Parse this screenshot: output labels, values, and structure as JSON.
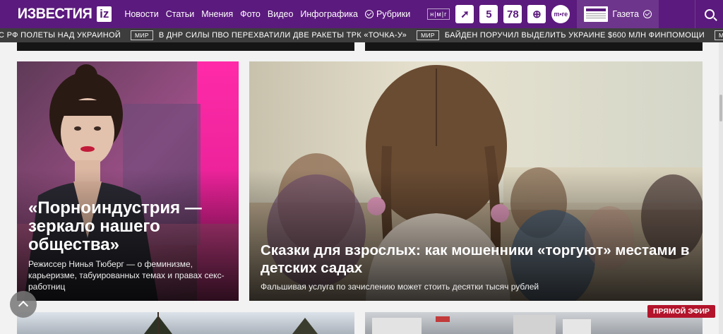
{
  "header": {
    "logo_text": "ИЗВЕСТИЯ",
    "logo_badge": "iz",
    "nav": [
      "Новости",
      "Статьи",
      "Мнения",
      "Фото",
      "Видео",
      "Инфографика"
    ],
    "rubriki_label": "Рубрики",
    "partners": {
      "nmg": "н|м|г",
      "p1": "➚",
      "p2": "5",
      "p3": "78",
      "p4": "⊕",
      "p5": "m•re"
    },
    "gazeta_label": "Газета"
  },
  "ticker": [
    {
      "tag": "",
      "text": "С РФ ПОЛЕТЫ НАД УКРАИНОЙ"
    },
    {
      "tag": "МИР",
      "text": "В ДНР СИЛЫ ПВО ПЕРЕХВАТИЛИ ДВЕ РАКЕТЫ ТРК «ТОЧКА-У»"
    },
    {
      "tag": "МИР",
      "text": "БАЙДЕН ПОРУЧИЛ ВЫДЕЛИТЬ УКРАИНЕ $600 МЛН ФИНПОМОЩИ"
    },
    {
      "tag": "МИР",
      "text": ""
    }
  ],
  "cards": {
    "left": {
      "title": "«Порноиндустрия — зеркало нашего общества»",
      "subtitle": "Режиссер Нинья Тюберг — о феминизме, карьеризме, табуированных темах и правах секс-работниц"
    },
    "right": {
      "title": "Сказки для взрослых: как мошенники «торгуют» местами в детских садах",
      "subtitle": "Фальшивая услуга по зачислению может стоить десятки тысяч рублей"
    }
  },
  "live_label": "ПРЯМОЙ ЭФИР",
  "colors": {
    "brand": "#5b1a7d",
    "ticker": "#3d3d3d",
    "live": "#b3142b"
  }
}
